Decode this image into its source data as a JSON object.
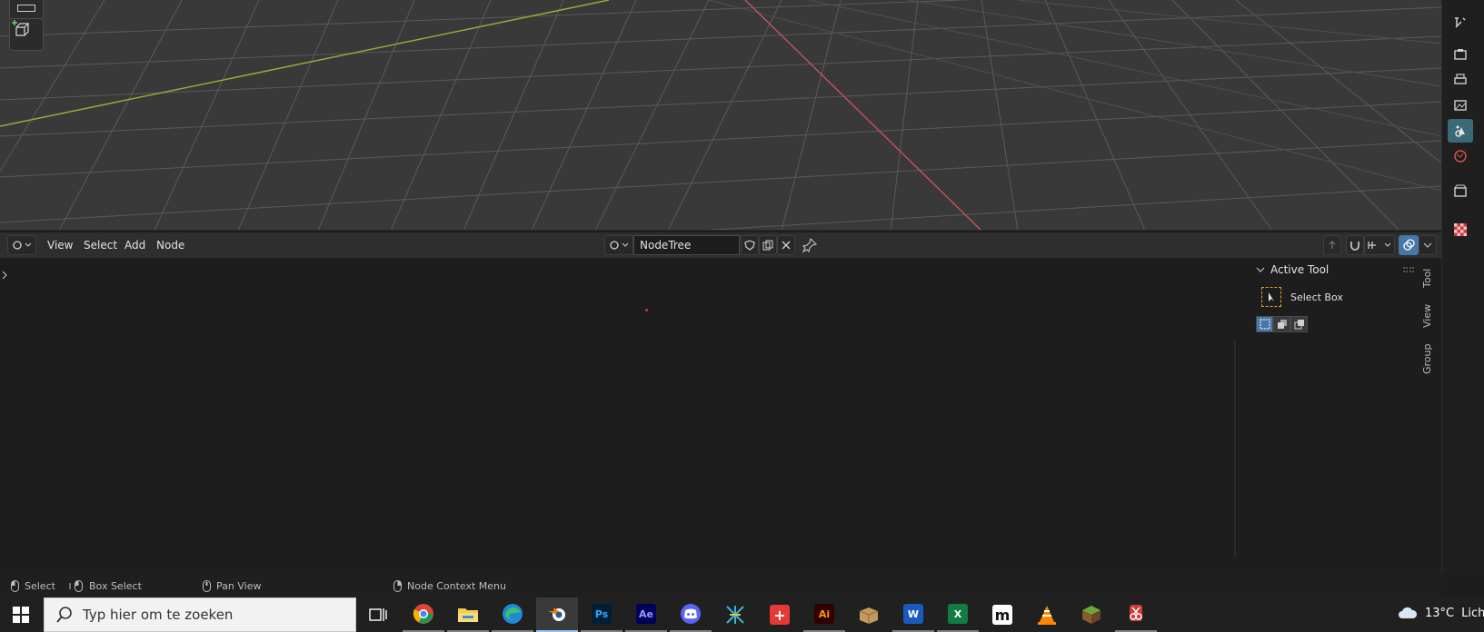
{
  "node_editor_header": {
    "menus": [
      "View",
      "Select",
      "Add",
      "Node"
    ],
    "nodetree_name": "NodeTree"
  },
  "sidebar": {
    "panel_title": "Active Tool",
    "tool_name": "Select Box",
    "tabs": [
      "Tool",
      "View",
      "Group"
    ]
  },
  "statusbar": {
    "items": [
      "Select",
      "Box Select",
      "Pan View",
      "Node Context Menu"
    ]
  },
  "taskbar": {
    "search_placeholder": "Typ hier om te zoeken",
    "weather_temp": "13°C",
    "weather_label": "Lich",
    "apps": [
      "windows-start",
      "task-view",
      "chrome",
      "file-explorer",
      "edge",
      "blender",
      "photoshop",
      "after-effects",
      "discord",
      "app-x",
      "app-red",
      "illustrator",
      "app-box",
      "word",
      "excel",
      "app-m",
      "vlc",
      "minecraft",
      "app-snip"
    ]
  },
  "colors": {
    "accent_active_tab": "#3a6a78",
    "x_axis": "#c0505a",
    "y_axis": "#8fae3a",
    "select_box_border": "#e59b2a"
  }
}
